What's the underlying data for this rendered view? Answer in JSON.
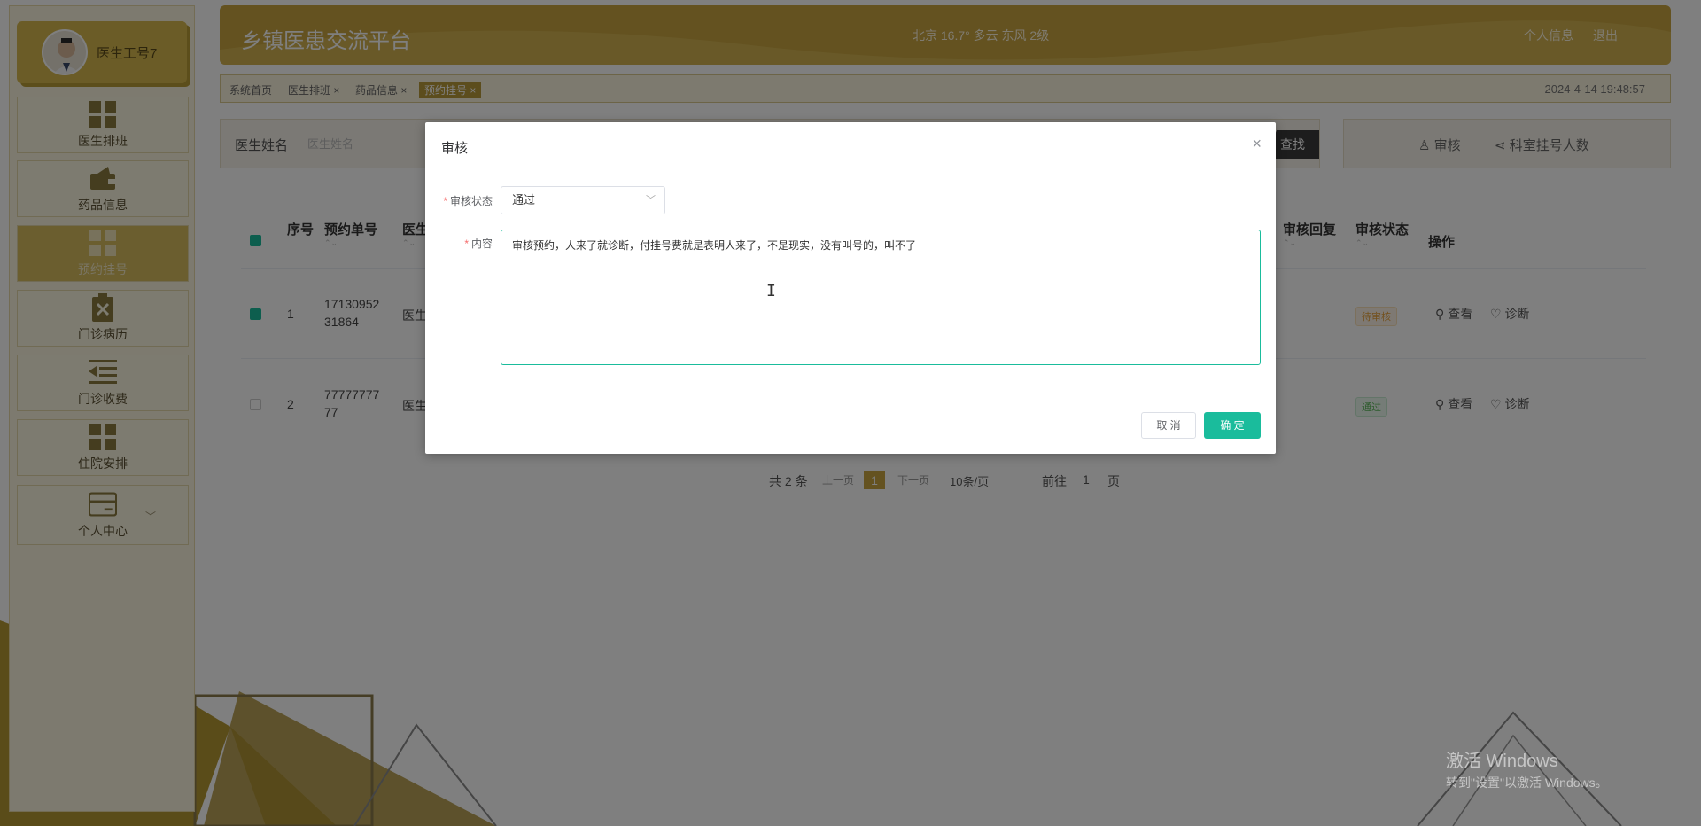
{
  "app": {
    "title": "乡镇医患交流平台",
    "weather": "北京 16.7° 多云 东风 2级",
    "links": [
      "个人信息",
      "退出"
    ],
    "datetime": "2024-4-14 19:48:57"
  },
  "user": {
    "name": "医生工号7"
  },
  "sidebar": {
    "items": [
      {
        "label": "医生排班",
        "icon": "grid-icon"
      },
      {
        "label": "药品信息",
        "icon": "wallet-icon"
      },
      {
        "label": "预约挂号",
        "icon": "grid-icon",
        "active": true
      },
      {
        "label": "门诊病历",
        "icon": "clipboard-x-icon"
      },
      {
        "label": "门诊收费",
        "icon": "indent-list-icon"
      },
      {
        "label": "住院安排",
        "icon": "grid-icon"
      },
      {
        "label": "个人中心",
        "icon": "card-icon"
      }
    ]
  },
  "tabs": {
    "items": [
      "系统首页",
      "医生排班 ×",
      "药品信息 ×",
      "预约挂号 ×"
    ]
  },
  "search": {
    "label": "医生姓名",
    "placeholder": "医生姓名",
    "button": "查找"
  },
  "actions": {
    "audit": "审核",
    "dept_count": "科室挂号人数"
  },
  "table": {
    "headers": {
      "seq": "序号",
      "order_no": "预约单号",
      "doctor": "医生",
      "reply": "审核回复",
      "status": "审核状态",
      "ops": "操作"
    },
    "rows": [
      {
        "seq": "1",
        "order_no_1": "17130952",
        "order_no_2": "31864",
        "doctor": "医生",
        "status": "待审核",
        "checked": true
      },
      {
        "seq": "2",
        "order_no_1": "77777777",
        "order_no_2": "77",
        "doctor": "医生",
        "status": "通过",
        "checked": false
      }
    ],
    "op_view": "查看",
    "op_diagnose": "诊断"
  },
  "pagination": {
    "total": "共 2 条",
    "prev": "上一页",
    "current": "1",
    "next": "下一页",
    "size": "10条/页",
    "goto": "前往",
    "goto_value": "1",
    "page_unit": "页"
  },
  "dialog": {
    "title": "审核",
    "status_label": "审核状态",
    "status_value": "通过",
    "content_label": "内容",
    "content_value": "审核预约，人来了就诊断，付挂号费就是表明人来了，不是现实，没有叫号的，叫不了",
    "cancel": "取 消",
    "ok": "确 定"
  },
  "watermark": {
    "line1": "激活 Windows",
    "line2": "转到\"设置\"以激活 Windows。"
  },
  "colors": {
    "gold": "#c8a540",
    "teal": "#1abc9c",
    "sidebar_bg": "#fbf5de"
  }
}
